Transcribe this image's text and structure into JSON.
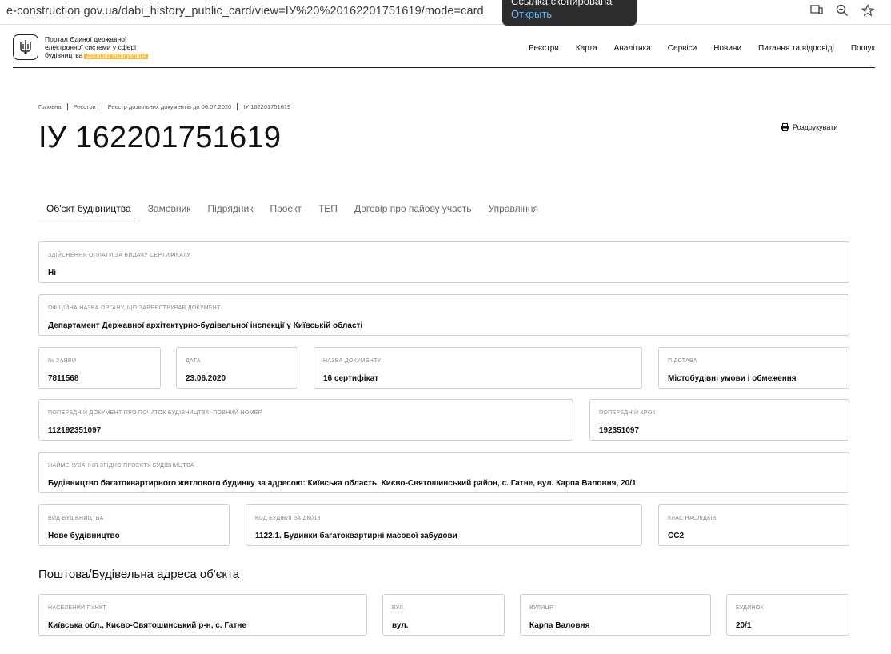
{
  "browser": {
    "url": "e-construction.gov.ua/dabi_history_public_card/view=ІУ%20%20162201751619/mode=card",
    "toast_title": "Ссылка скопирована",
    "toast_action": "Открыть"
  },
  "header": {
    "logo_line1": "Портал Єдиної державної",
    "logo_line2": "електронної системи у сфері",
    "logo_line3": "будівництва",
    "tag": "Дослідна експлуатація",
    "nav": [
      "Реєстри",
      "Карта",
      "Аналітика",
      "Сервіси",
      "Новини",
      "Питання та відповіді",
      "Пошук"
    ]
  },
  "breadcrumbs": [
    "Головна",
    "Реєстри",
    "Реєстр дозвільних документів до 06.07.2020",
    "ІУ 162201751619"
  ],
  "page_title": "ІУ 162201751619",
  "print_label": "Роздрукувати",
  "tabs": [
    "Об'єкт будівництва",
    "Замовник",
    "Підрядник",
    "Проект",
    "ТЕП",
    "Договір про пайову участь",
    "Управління"
  ],
  "fields": {
    "payment": {
      "label": "Здійснення оплати за видачу сертифікату",
      "value": "Ні"
    },
    "authority": {
      "label": "Офіційна назва органу, що зареєстрував документ",
      "value": "Департамент Державної архітектурно-будівельної інспекції у Київській області"
    },
    "app_no": {
      "label": "№ заяви",
      "value": "7811568"
    },
    "date": {
      "label": "Дата",
      "value": "23.06.2020"
    },
    "doc_name": {
      "label": "Назва документу",
      "value": "16 сертифікат"
    },
    "basis": {
      "label": "Підстава",
      "value": "Містобудівні умови і обмеження"
    },
    "prev_doc": {
      "label": "Попередній документ про початок будівництва, повний номер",
      "value": "112192351097"
    },
    "prev_step": {
      "label": "Попередній крок",
      "value": "192351097"
    },
    "project_name": {
      "label": "Найменування згідно проекту будівництва",
      "value": "Будівництво багатоквартирного житлового будинку за адресою: Київська область, Києво-Святошинський район, с. Гатне, вул. Карпа Валовня, 20/1"
    },
    "build_type": {
      "label": "Вид будівництва",
      "value": "Нове будівництво"
    },
    "dk_code": {
      "label": "Код будівлі за ДК018",
      "value": "1122.1. Будинки багатоквартирні масової забудови"
    },
    "class": {
      "label": "Клас наслідків",
      "value": "СС2"
    }
  },
  "address_heading": "Поштова/Будівельна адреса об'єкта",
  "address": {
    "locality": {
      "label": "Населений пункт",
      "value": "Київська обл., Києво-Святошинський р-н, с. Гатне"
    },
    "street_type": {
      "label": "Вул.",
      "value": "вул."
    },
    "street": {
      "label": "Вулиця",
      "value": "Карпа Валовня"
    },
    "building": {
      "label": "Будинок",
      "value": "20/1"
    }
  }
}
